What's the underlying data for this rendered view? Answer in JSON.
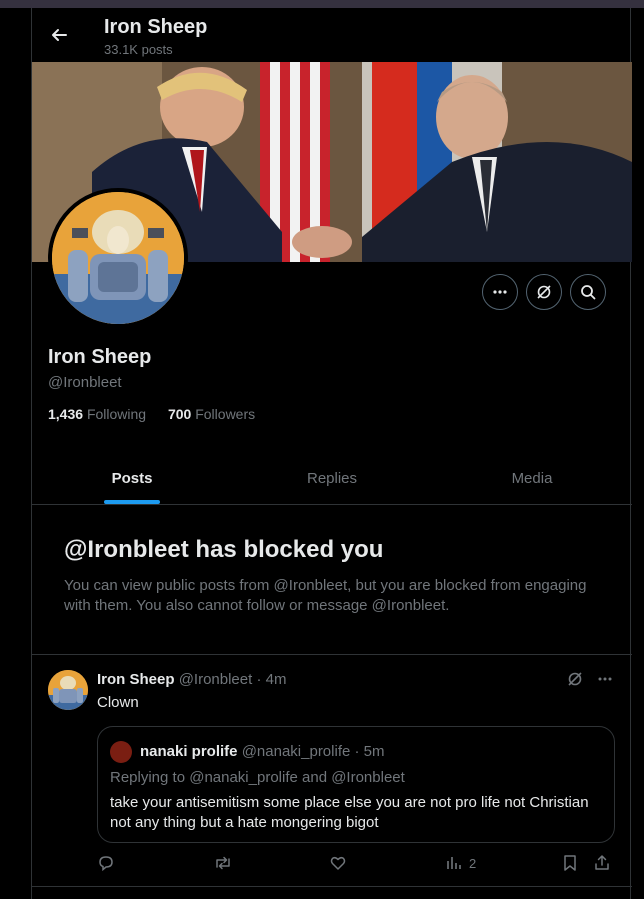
{
  "header": {
    "name": "Iron Sheep",
    "posts_count": "33.1K posts"
  },
  "profile": {
    "name": "Iron Sheep",
    "handle": "@Ironbleet",
    "following_count": "1,436",
    "following_label": "Following",
    "followers_count": "700",
    "followers_label": "Followers"
  },
  "tabs": [
    {
      "label": "Posts",
      "active": true
    },
    {
      "label": "Replies",
      "active": false
    },
    {
      "label": "Media",
      "active": false
    }
  ],
  "blocked": {
    "title": "@Ironbleet has blocked you",
    "text": "You can view public posts from @Ironbleet, but you are blocked from engaging with them. You also cannot follow or message @Ironbleet."
  },
  "tweet": {
    "author": "Iron Sheep",
    "handle_time": "@Ironbleet · 4m",
    "text": "Clown",
    "quote": {
      "author": "nanaki prolife",
      "handle_time": "@nanaki_prolife · 5m",
      "replying_to": "Replying to @nanaki_prolife and @Ironbleet",
      "text": "take your antisemitism some place else you are not pro life not Christian not any thing but a hate mongering bigot"
    },
    "views": "2"
  },
  "icons": [
    "back-arrow-icon",
    "more-icon",
    "grok-icon",
    "search-icon",
    "reply-icon",
    "repost-icon",
    "like-icon",
    "views-icon",
    "bookmark-icon",
    "share-icon"
  ],
  "colors": {
    "accent": "#1d9bf0",
    "background": "#000000",
    "muted": "#71767b",
    "text": "#e7e9ea",
    "border": "#2f3336"
  }
}
